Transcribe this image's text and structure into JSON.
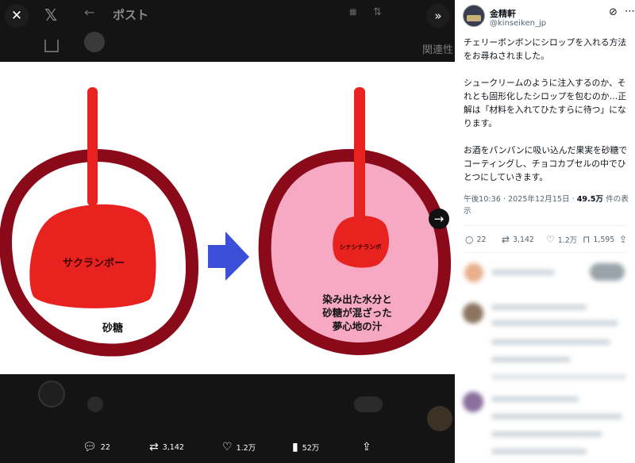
{
  "viewer": {
    "close_icon": "close-icon",
    "expand_icon": "chevron-double-right-icon",
    "next_icon": "arrow-right-icon",
    "actions": {
      "replies": "22",
      "reposts": "3,142",
      "likes": "1.2万",
      "views": "52万"
    }
  },
  "image": {
    "left_label": "サクランボー",
    "sugar_label": "砂糖",
    "right_small_label": "シナシナランボ",
    "right_caption_line1": "染み出た水分と",
    "right_caption_line2": "砂糖が混ざった",
    "right_caption_line3": "夢心地の汁",
    "colors": {
      "outer_ring": "#8b0a1a",
      "cherry": "#e8231f",
      "syrup_pink": "#f7a9c4",
      "arrow": "#3c4fd8"
    }
  },
  "background": {
    "page_title": "ポスト",
    "related": "関連性"
  },
  "tweet": {
    "author_name": "金精軒",
    "author_handle": "@kinseiken_jp",
    "paragraph1": "チェリーボンボンにシロップを入れる方法をお尋ねされました。",
    "paragraph2": "シュークリームのように注入するのか、それとも固形化したシロップを包むのか…正解は「材料を入れてひたすらに待つ」になります。",
    "paragraph3": "お酒をパンパンに吸い込んだ果実を砂糖でコーティングし、チョコカプセルの中でひとつにしていきます。",
    "time": "午後10:36 · 2025年12月15日 · ",
    "views": "49.5万",
    "views_suffix": " 件の表示",
    "stats": {
      "replies": "22",
      "reposts": "3,142",
      "likes": "1.2万",
      "bookmarks": "1,595"
    }
  }
}
